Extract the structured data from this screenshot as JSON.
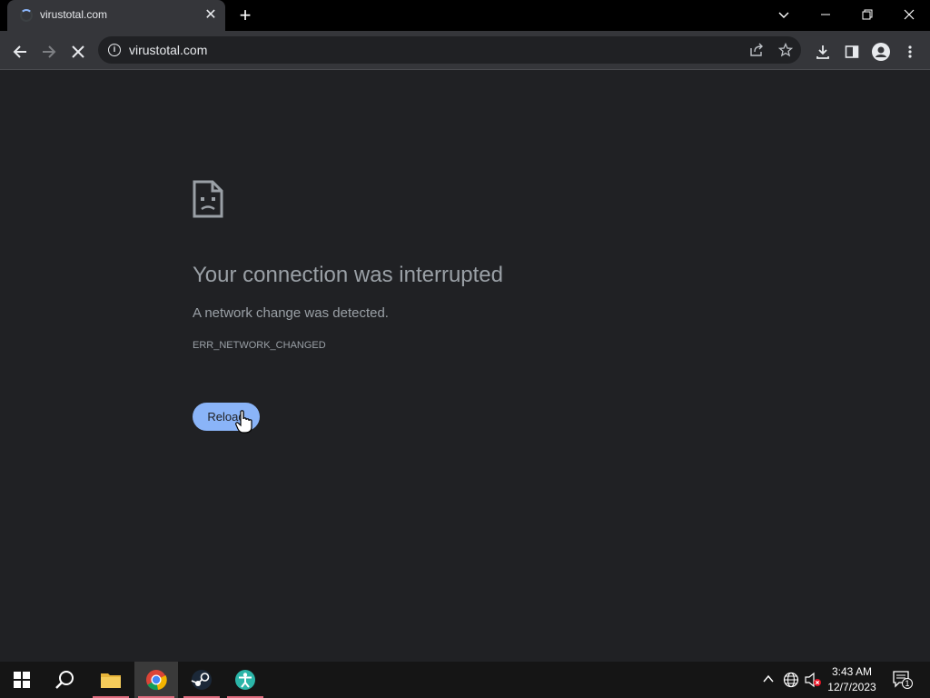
{
  "browser": {
    "tab": {
      "title": "virustotal.com"
    },
    "omnibox": {
      "url": "virustotal.com"
    }
  },
  "error_page": {
    "headline": "Your connection was interrupted",
    "description": "A network change was detected.",
    "error_code": "ERR_NETWORK_CHANGED",
    "reload_label": "Reload"
  },
  "taskbar": {
    "pinned_apps": [
      "start-icon",
      "search-icon",
      "file-explorer-icon",
      "chrome-icon",
      "steam-icon",
      "accessibility-app-icon"
    ],
    "clock": {
      "time": "3:43 AM",
      "date": "12/7/2023"
    },
    "notifications_count": "1"
  },
  "colors": {
    "page_background": "#202124",
    "toolbar": "#35363a",
    "accent_button": "#8ab4f8",
    "text_muted": "#9aa0a6"
  }
}
